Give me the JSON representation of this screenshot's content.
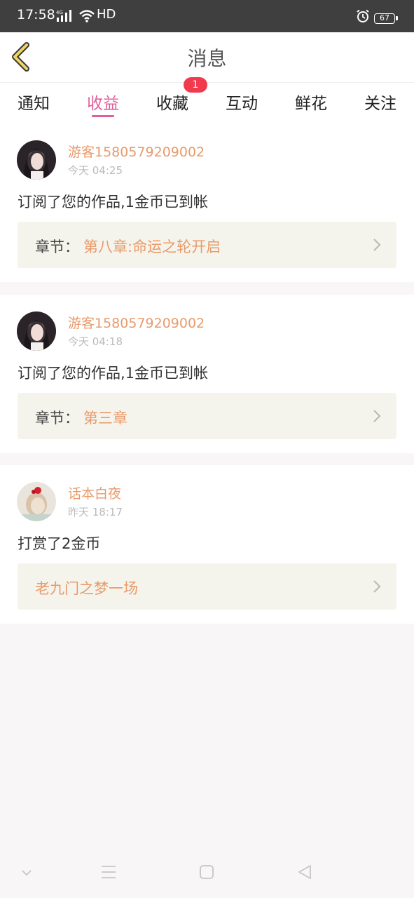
{
  "status_bar": {
    "time": "17:58",
    "network": "4G",
    "hd": "HD",
    "battery": "67"
  },
  "header": {
    "title": "消息",
    "back_icon": "chevron-left-icon"
  },
  "tabs": [
    {
      "label": "通知",
      "active": false
    },
    {
      "label": "收益",
      "active": true
    },
    {
      "label": "收藏",
      "active": false,
      "badge": "1"
    },
    {
      "label": "互动",
      "active": false
    },
    {
      "label": "鲜花",
      "active": false
    },
    {
      "label": "关注",
      "active": false
    }
  ],
  "messages": [
    {
      "username": "游客1580579209002",
      "time": "今天 04:25",
      "text": "订阅了您的作品,1金币已到帐",
      "link_label": "章节：",
      "link_value": "第八章:命运之轮开启"
    },
    {
      "username": "游客1580579209002",
      "time": "今天 04:18",
      "text": "订阅了您的作品,1金币已到帐",
      "link_label": "章节：",
      "link_value": "第三章"
    },
    {
      "username": "话本白夜",
      "time": "昨天 18:17",
      "text": "打赏了2金币",
      "link_label": "",
      "link_value": "老九门之梦一场"
    }
  ],
  "colors": {
    "accent": "#e0609a",
    "username": "#e89a6a",
    "badge": "#f23a4e",
    "link_bg": "#f5f4ec"
  }
}
